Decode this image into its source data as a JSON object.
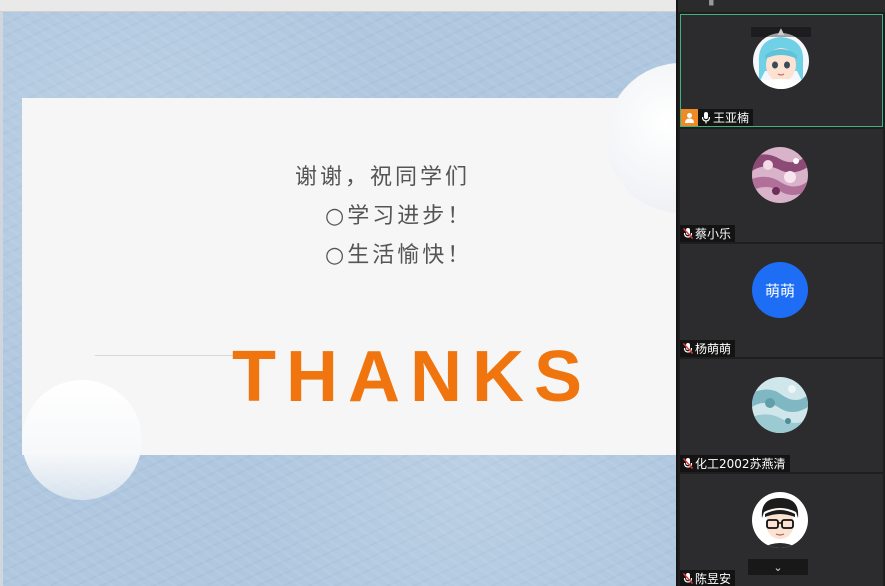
{
  "slide": {
    "lines": [
      "谢谢，祝同学们",
      "○学习进步！",
      "○生活愉快！"
    ],
    "thanks": "THANKS"
  },
  "panel": {
    "participants": [
      {
        "name": "王亚楠",
        "avatar": "anime-girl-avatar",
        "host": true,
        "active": true
      },
      {
        "name": "蔡小乐",
        "avatar": "pink-floral-avatar",
        "host": false,
        "active": false
      },
      {
        "name": "杨萌萌",
        "avatar_text": "萌萌",
        "host": false,
        "active": false
      },
      {
        "name": "化工2002苏燕清",
        "avatar": "teal-watercolor-avatar",
        "host": false,
        "active": false
      },
      {
        "name": "陈昱安",
        "avatar": "glasses-boy-avatar",
        "host": false,
        "active": false
      }
    ]
  },
  "colors": {
    "thanks": "#f0750e",
    "slide_bg": "#afc7df",
    "active_border": "#3fb37f",
    "host_badge": "#f08a24",
    "avatar_blue": "#1e6ef5"
  },
  "icons": [
    "mic-muted-icon",
    "mic-icon",
    "host-person-icon",
    "chevron-up-icon",
    "chevron-down-icon"
  ]
}
